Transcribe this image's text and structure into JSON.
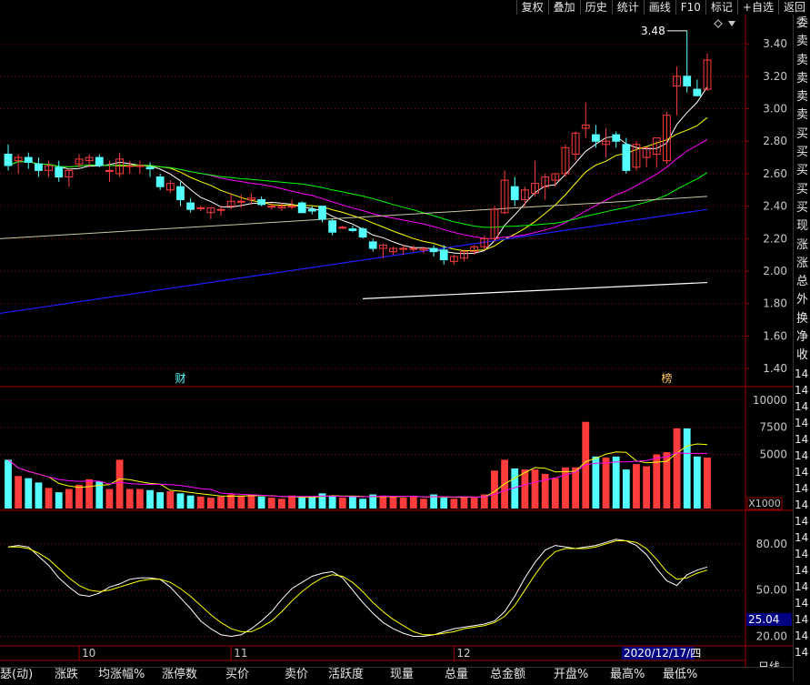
{
  "toolbar": {
    "buttons": [
      "复权",
      "叠加",
      "历史",
      "统计",
      "画线",
      "F10",
      "标记",
      "+自选",
      "返回"
    ]
  },
  "colors": {
    "up": "#ff3c3c",
    "down": "#54ffff",
    "ma5": "#ffffff",
    "ma10": "#ffff00",
    "ma20": "#ff00ff",
    "ma30": "#00ff00",
    "ma60": "#ffffff",
    "ma250": "#1e1eff",
    "grid": "#8b0000",
    "axis_text": "#c8c8c8",
    "k_line": "#ffffff",
    "d_line": "#ffff00"
  },
  "price_panel": {
    "ylim": [
      1.3,
      3.58
    ],
    "ticks": [
      "3.40",
      "3.20",
      "3.00",
      "2.80",
      "2.60",
      "2.40",
      "2.20",
      "2.00",
      "1.80",
      "1.60",
      "1.40"
    ],
    "max_label": "3.48",
    "markers": [
      {
        "label": "财",
        "index": 17
      },
      {
        "label": "榜",
        "index": 65
      }
    ]
  },
  "volume_panel": {
    "ylim": [
      0,
      11000
    ],
    "ticks": [
      "10000",
      "7500",
      "5000"
    ],
    "unit_label": "X1000"
  },
  "kdj_panel": {
    "ylim": [
      15,
      100
    ],
    "ticks": [
      "80.00",
      "50.00",
      "20.00"
    ],
    "current_value": "25.04"
  },
  "x_axis": {
    "month_labels": [
      {
        "label": "10",
        "index": 7
      },
      {
        "label": "11",
        "index": 22
      },
      {
        "label": "12",
        "index": 44
      }
    ],
    "cursor_date": "2020/12/17/四",
    "cursor_index": 62
  },
  "period": {
    "label": "日线",
    "plus": "+",
    "minus": "-"
  },
  "right_column": {
    "labels": [
      "委",
      "卖",
      "卖",
      "卖",
      "卖",
      "卖",
      "买",
      "买",
      "买",
      "买",
      "买",
      "现",
      "涨",
      "涨",
      "总",
      "外",
      "换",
      "净",
      "收"
    ],
    "numbers": [
      "14",
      "14",
      "14",
      "14",
      "14",
      "14",
      "14",
      "14",
      "14",
      "14",
      "14",
      "14",
      "14",
      "14",
      "14",
      "14",
      "14",
      "14"
    ]
  },
  "footer": {
    "columns": [
      "瑟(动)",
      "涨跌",
      "均涨幅%",
      "涨停数",
      "买价",
      "卖价",
      "活跃度",
      "现量",
      "总量",
      "总金额",
      "开盘%",
      "最高%",
      "最低%"
    ]
  },
  "chart_data": {
    "type": "candlestick",
    "ohlc": [
      [
        2.72,
        2.78,
        2.62,
        2.65
      ],
      [
        2.68,
        2.72,
        2.6,
        2.7
      ],
      [
        2.7,
        2.73,
        2.63,
        2.67
      ],
      [
        2.66,
        2.7,
        2.58,
        2.62
      ],
      [
        2.62,
        2.68,
        2.58,
        2.65
      ],
      [
        2.64,
        2.68,
        2.55,
        2.58
      ],
      [
        2.58,
        2.63,
        2.52,
        2.62
      ],
      [
        2.66,
        2.72,
        2.64,
        2.69
      ],
      [
        2.68,
        2.72,
        2.64,
        2.7
      ],
      [
        2.7,
        2.72,
        2.64,
        2.65
      ],
      [
        2.62,
        2.68,
        2.55,
        2.62
      ],
      [
        2.6,
        2.73,
        2.58,
        2.69
      ],
      [
        2.65,
        2.68,
        2.6,
        2.65
      ],
      [
        2.65,
        2.68,
        2.6,
        2.65
      ],
      [
        2.64,
        2.67,
        2.58,
        2.63
      ],
      [
        2.58,
        2.6,
        2.5,
        2.52
      ],
      [
        2.5,
        2.56,
        2.48,
        2.54
      ],
      [
        2.52,
        2.55,
        2.4,
        2.44
      ],
      [
        2.42,
        2.45,
        2.36,
        2.38
      ],
      [
        2.39,
        2.4,
        2.37,
        2.39
      ],
      [
        2.36,
        2.39,
        2.32,
        2.39
      ],
      [
        2.38,
        2.4,
        2.34,
        2.38
      ],
      [
        2.4,
        2.48,
        2.38,
        2.43
      ],
      [
        2.43,
        2.47,
        2.39,
        2.43
      ],
      [
        2.44,
        2.48,
        2.41,
        2.45
      ],
      [
        2.44,
        2.46,
        2.4,
        2.41
      ],
      [
        2.4,
        2.42,
        2.38,
        2.4
      ],
      [
        2.39,
        2.42,
        2.37,
        2.4
      ],
      [
        2.4,
        2.44,
        2.38,
        2.4
      ],
      [
        2.42,
        2.43,
        2.37,
        2.36
      ],
      [
        2.38,
        2.4,
        2.35,
        2.37
      ],
      [
        2.4,
        2.4,
        2.3,
        2.32
      ],
      [
        2.31,
        2.32,
        2.22,
        2.24
      ],
      [
        2.27,
        2.28,
        2.26,
        2.27
      ],
      [
        2.26,
        2.28,
        2.24,
        2.25
      ],
      [
        2.26,
        2.27,
        2.2,
        2.21
      ],
      [
        2.18,
        2.2,
        2.12,
        2.14
      ],
      [
        2.14,
        2.17,
        2.08,
        2.16
      ],
      [
        2.12,
        2.15,
        2.1,
        2.14
      ],
      [
        2.14,
        2.16,
        2.1,
        2.14
      ],
      [
        2.14,
        2.16,
        2.12,
        2.14
      ],
      [
        2.13,
        2.15,
        2.11,
        2.14
      ],
      [
        2.14,
        2.16,
        2.09,
        2.12
      ],
      [
        2.13,
        2.16,
        2.04,
        2.07
      ],
      [
        2.06,
        2.1,
        2.04,
        2.09
      ],
      [
        2.08,
        2.13,
        2.06,
        2.12
      ],
      [
        2.12,
        2.16,
        2.1,
        2.15
      ],
      [
        2.15,
        2.22,
        2.13,
        2.2
      ],
      [
        2.2,
        2.4,
        2.18,
        2.38
      ],
      [
        2.36,
        2.62,
        2.35,
        2.56
      ],
      [
        2.52,
        2.58,
        2.4,
        2.44
      ],
      [
        2.44,
        2.52,
        2.4,
        2.5
      ],
      [
        2.48,
        2.68,
        2.46,
        2.54
      ],
      [
        2.52,
        2.6,
        2.44,
        2.58
      ],
      [
        2.56,
        2.6,
        2.52,
        2.6
      ],
      [
        2.6,
        2.78,
        2.58,
        2.76
      ],
      [
        2.72,
        2.86,
        2.68,
        2.85
      ],
      [
        2.88,
        3.04,
        2.82,
        2.9
      ],
      [
        2.84,
        2.9,
        2.76,
        2.8
      ],
      [
        2.78,
        2.88,
        2.7,
        2.8
      ],
      [
        2.84,
        2.86,
        2.76,
        2.8
      ],
      [
        2.78,
        2.82,
        2.6,
        2.62
      ],
      [
        2.64,
        2.8,
        2.62,
        2.78
      ],
      [
        2.7,
        2.76,
        2.64,
        2.76
      ],
      [
        2.72,
        2.8,
        2.64,
        2.82
      ],
      [
        2.68,
        2.98,
        2.66,
        2.96
      ],
      [
        3.14,
        3.26,
        2.96,
        3.2
      ],
      [
        3.2,
        3.48,
        3.1,
        3.14
      ],
      [
        3.12,
        3.18,
        3.08,
        3.08
      ],
      [
        3.12,
        3.34,
        3.11,
        3.3
      ]
    ],
    "ma_levels": {
      "ma60_start": 2.2,
      "ma60_end": 2.46,
      "ma250_start": 1.74,
      "ma250_end": 2.38,
      "second_line_start": 1.83,
      "second_line_end": 1.93
    },
    "volume": [
      4500,
      3000,
      2800,
      2400,
      1900,
      1500,
      1800,
      2200,
      2700,
      2500,
      1800,
      4500,
      1800,
      1800,
      1700,
      1500,
      1600,
      1400,
      1200,
      1100,
      1000,
      1100,
      1300,
      1200,
      1300,
      1100,
      1000,
      900,
      1200,
      1000,
      1100,
      1400,
      1200,
      1000,
      1100,
      900,
      1300,
      1200,
      1100,
      1000,
      1100,
      900,
      1300,
      1000,
      900,
      1100,
      1000,
      1300,
      3500,
      4500,
      3700,
      3600,
      3600,
      3200,
      2800,
      3800,
      3800,
      8000,
      4800,
      4700,
      4800,
      3600,
      4100,
      3900,
      5000,
      5200,
      7400,
      7400,
      4800,
      4700
    ],
    "kdj_k": [
      78,
      79,
      78,
      72,
      66,
      58,
      52,
      47,
      46,
      48,
      52,
      54,
      57,
      58,
      58,
      57,
      52,
      45,
      38,
      30,
      25,
      21,
      20,
      21,
      25,
      30,
      36,
      44,
      51,
      55,
      59,
      61,
      62,
      58,
      50,
      42,
      35,
      29,
      25,
      22,
      20,
      20,
      21,
      23,
      25,
      26,
      27,
      28,
      30,
      36,
      46,
      58,
      68,
      76,
      79,
      78,
      77,
      78,
      79,
      81,
      83,
      82,
      79,
      73,
      64,
      56,
      53,
      60,
      63,
      65
    ],
    "kdj_d": [
      78,
      78,
      77,
      74,
      70,
      64,
      58,
      53,
      50,
      49,
      50,
      52,
      54,
      56,
      57,
      57,
      55,
      51,
      46,
      40,
      34,
      29,
      25,
      23,
      23,
      26,
      30,
      36,
      43,
      49,
      54,
      58,
      60,
      59,
      55,
      49,
      42,
      36,
      31,
      27,
      23,
      21,
      21,
      22,
      23,
      25,
      26,
      27,
      29,
      33,
      40,
      50,
      60,
      69,
      75,
      77,
      77,
      77,
      78,
      80,
      82,
      82,
      81,
      77,
      70,
      62,
      57,
      58,
      61,
      63
    ]
  }
}
